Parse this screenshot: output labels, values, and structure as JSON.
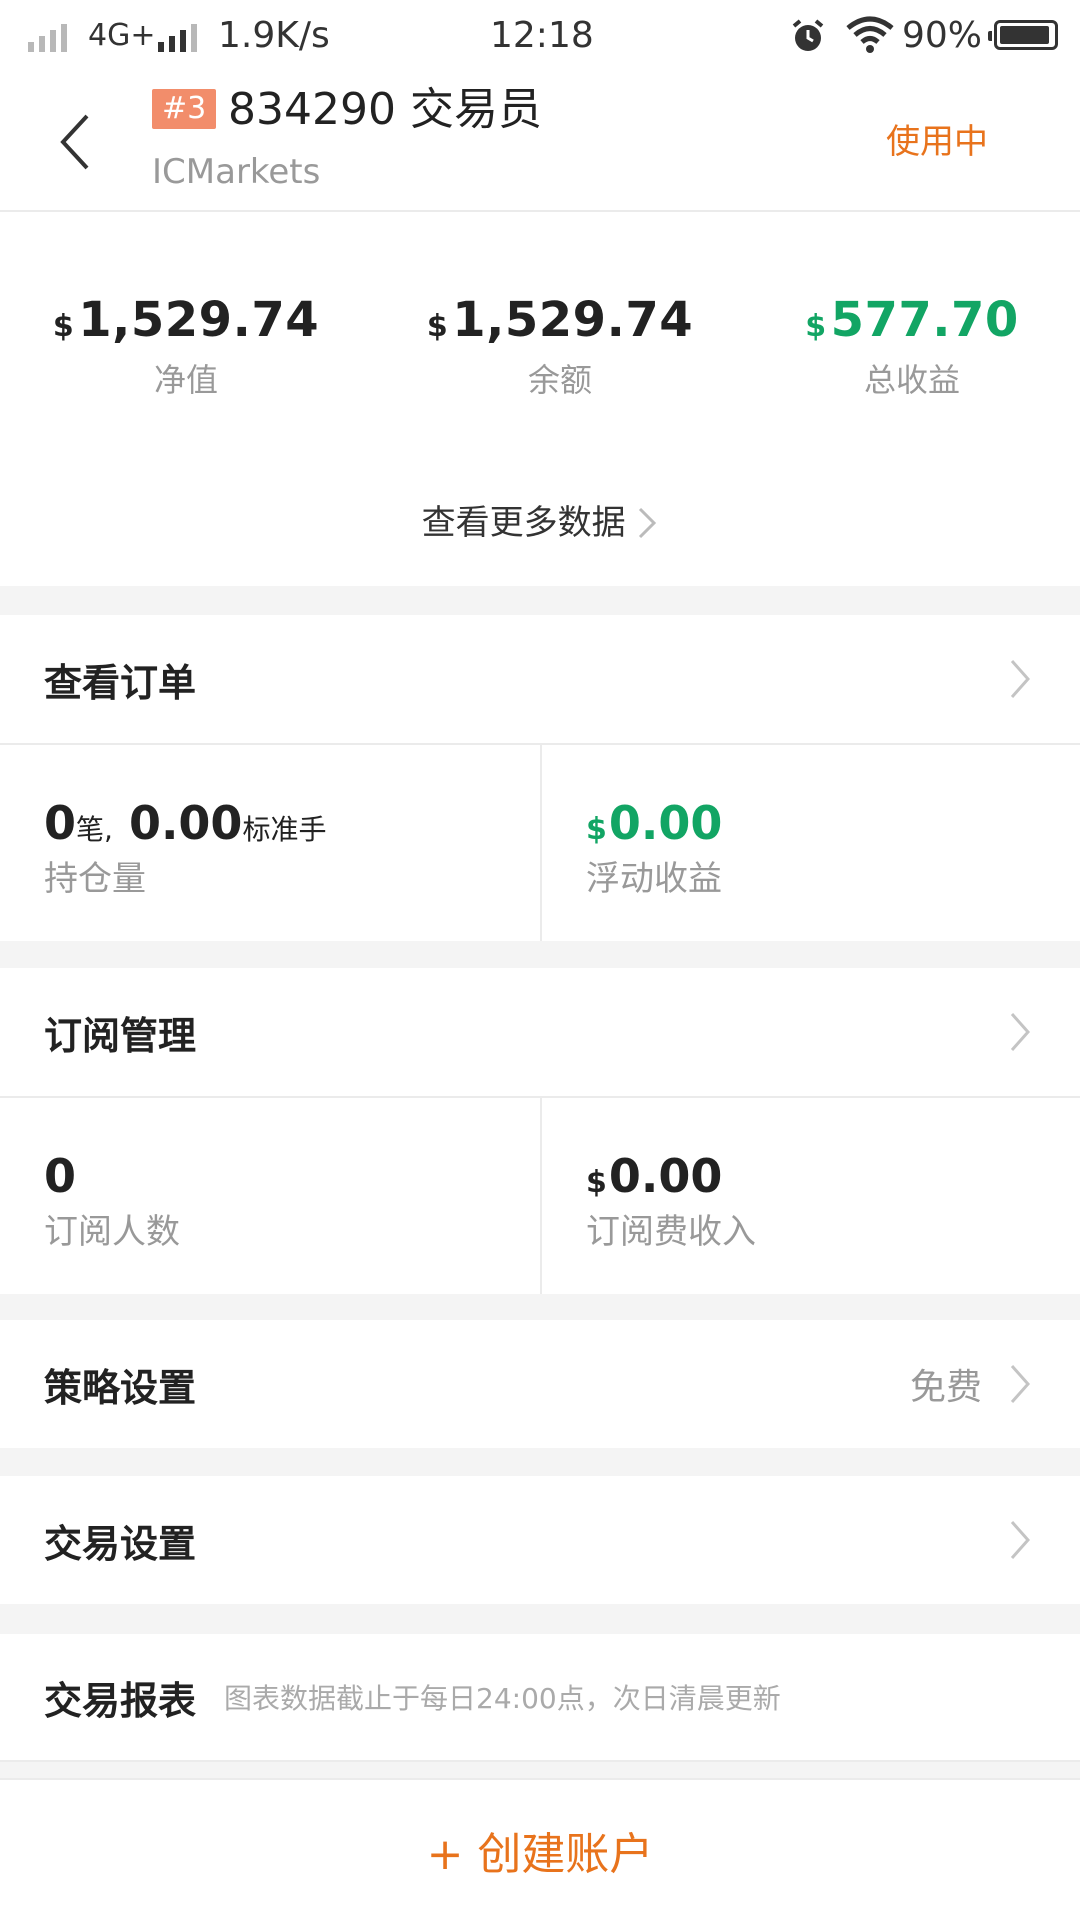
{
  "status_bar": {
    "network_type": "4G+",
    "speed": "1.9K/s",
    "time": "12:18",
    "battery": "90%"
  },
  "header": {
    "rank": "#3",
    "account_title": "834290 交易员",
    "broker": "ICMarkets",
    "status": "使用中"
  },
  "summary": {
    "currency": "$",
    "net_value": "1,529.74",
    "net_value_label": "净值",
    "balance": "1,529.74",
    "balance_label": "余额",
    "total_profit": "577.70",
    "total_profit_label": "总收益",
    "more_link": "查看更多数据"
  },
  "orders": {
    "title": "查看订单",
    "position_count": "0",
    "position_count_unit": "笔,",
    "position_lots": "0.00",
    "position_lots_unit": "标准手",
    "position_label": "持仓量",
    "floating_currency": "$",
    "floating_value": "0.00",
    "floating_label": "浮动收益"
  },
  "subscription": {
    "title": "订阅管理",
    "subscribers": "0",
    "subscribers_label": "订阅人数",
    "income_currency": "$",
    "income_value": "0.00",
    "income_label": "订阅费收入"
  },
  "strategy": {
    "title": "策略设置",
    "value": "免费"
  },
  "trade_settings": {
    "title": "交易设置"
  },
  "report": {
    "title": "交易报表",
    "hint": "图表数据截止于每日24:00点，次日清晨更新"
  },
  "create_account": {
    "label": "+ 创建账户"
  },
  "colors": {
    "accent_orange": "#e8731c",
    "profit_green": "#12a564",
    "badge": "#f28d6b"
  }
}
